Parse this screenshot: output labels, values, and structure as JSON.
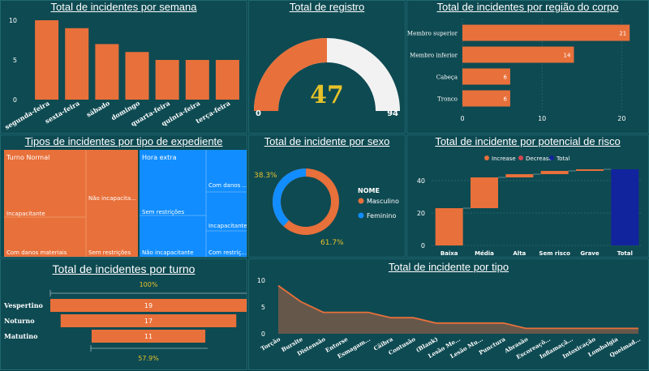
{
  "colors": {
    "orange": "#e8703a",
    "blue": "#118dff",
    "navy": "#12239e",
    "gauge_bg": "#f2f2f2",
    "text": "#ffffff",
    "gold": "#e6c229",
    "green": "#2e8b57"
  },
  "weekly": {
    "title": "Total de incidentes por semana",
    "chart_data": {
      "type": "bar",
      "categories": [
        "segunda-feira",
        "sexta-feira",
        "sábado",
        "domingo",
        "quarta-feira",
        "quinta-feira",
        "terça-feira"
      ],
      "values": [
        10,
        9,
        7,
        6,
        5,
        5,
        5
      ],
      "yticks": [
        "0",
        "5",
        "10"
      ],
      "ylim": [
        0,
        10
      ]
    }
  },
  "gauge": {
    "title": "Total de registro",
    "chart_data": {
      "type": "gauge",
      "value": 47,
      "min": 0,
      "max": 94
    },
    "value_label": "47",
    "min_label": "0",
    "max_label": "94"
  },
  "body_region": {
    "title": "Total de incidentes por região do corpo",
    "chart_data": {
      "type": "bar",
      "orientation": "horizontal",
      "categories": [
        "Membro superior",
        "Membro inferior",
        "Cabeça",
        "Tronco"
      ],
      "values": [
        21,
        14,
        6,
        6
      ],
      "xlim": [
        0,
        22
      ],
      "xticks": [
        "0",
        "10",
        "20"
      ]
    }
  },
  "shift_type": {
    "title": "Tipos de incidentes por tipo de expediente",
    "chart_data": {
      "type": "treemap",
      "groups": [
        {
          "name": "Turno Normal",
          "children": [
            {
              "name": "Incapacitante"
            },
            {
              "name": "Com danos materiais"
            },
            {
              "name": "Não incapacita..."
            },
            {
              "name": "Sem restrições"
            }
          ]
        },
        {
          "name": "Hora extra",
          "children": [
            {
              "name": "Sem restrições"
            },
            {
              "name": "Não incapacitante"
            },
            {
              "name": "Com danos ..."
            },
            {
              "name": "Incapacitante"
            },
            {
              "name": "Com restriç..."
            }
          ]
        }
      ]
    }
  },
  "sex": {
    "title": "Total de incidente por sexo",
    "legend_title": "NOME",
    "chart_data": {
      "type": "donut",
      "labels": [
        "Masculino",
        "Feminino"
      ],
      "values": [
        61.7,
        38.3
      ]
    },
    "label_male": "61.7%",
    "label_female": "38.3%"
  },
  "risk": {
    "title": "Total de incidente por potencial de risco",
    "legend": [
      "Increase",
      "Decrease",
      "Total"
    ],
    "chart_data": {
      "type": "waterfall",
      "categories": [
        "Baixa",
        "Média",
        "Alta",
        "Sem risco",
        "Grave",
        "Total"
      ],
      "values": [
        23,
        19,
        2,
        2,
        1,
        47
      ],
      "ylim": [
        0,
        50
      ],
      "yticks": [
        "0",
        "20",
        "40"
      ]
    }
  },
  "turno": {
    "title": "Total de incidentes por turno",
    "top_label": "100%",
    "bottom_label": "57.9%",
    "chart_data": {
      "type": "funnel",
      "categories": [
        "Vespertino",
        "Noturno",
        "Matutino"
      ],
      "values": [
        19,
        17,
        11
      ]
    }
  },
  "tipo": {
    "title": "Total de incidente por tipo",
    "chart_data": {
      "type": "area",
      "categories": [
        "Torção",
        "Bursite",
        "Distensão",
        "Entorse",
        "Esmagam...",
        "Cãibra",
        "Contusão",
        "(Blank)",
        "Lesão Me...",
        "Lesão Mu...",
        "Punctura",
        "Abrasão",
        "Escoreaçõ...",
        "Inflamaçã...",
        "Intoxicação",
        "Lombalgia",
        "Queimad..."
      ],
      "values": [
        9,
        6,
        4,
        4,
        4,
        3,
        3,
        2,
        2,
        2,
        2,
        1,
        1,
        1,
        1,
        1,
        1
      ],
      "ylim": [
        0,
        10
      ],
      "yticks": [
        "0",
        "5",
        "10"
      ]
    }
  }
}
